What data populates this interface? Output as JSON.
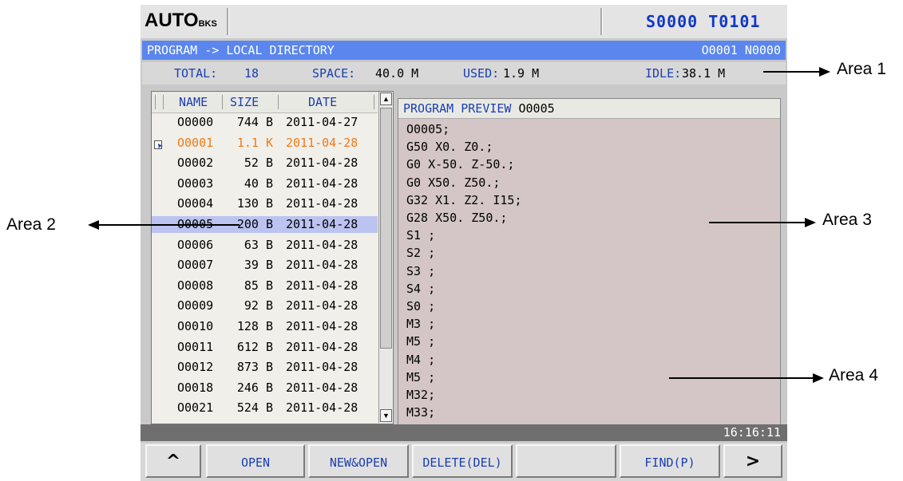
{
  "top_bar": {
    "mode": "AUTO",
    "mode_sub": "BKS",
    "spindle": "S0000",
    "tool": "T0101"
  },
  "title_bar": {
    "path": "PROGRAM -> LOCAL DIRECTORY",
    "program_info": "O0001 N0000"
  },
  "stats": {
    "total_label": "TOTAL:",
    "total_value": "18",
    "space_label": "SPACE:",
    "space_value": "40.0 M",
    "used_label": "USED:",
    "used_value": "1.9 M",
    "idle_label": "IDLE:",
    "idle_value": "38.1 M"
  },
  "file_list": {
    "headers": {
      "name": "NAME",
      "size": "SIZE",
      "date": "DATE"
    },
    "rows": [
      {
        "name": "O0000",
        "size": "744 B",
        "date": "2011-04-27"
      },
      {
        "name": "O0001",
        "size": "1.1 K",
        "date": "2011-04-28"
      },
      {
        "name": "O0002",
        "size": "52 B",
        "date": "2011-04-28"
      },
      {
        "name": "O0003",
        "size": "40 B",
        "date": "2011-04-28"
      },
      {
        "name": "O0004",
        "size": "130 B",
        "date": "2011-04-28"
      },
      {
        "name": "O0005",
        "size": "200 B",
        "date": "2011-04-28"
      },
      {
        "name": "O0006",
        "size": "63 B",
        "date": "2011-04-28"
      },
      {
        "name": "O0007",
        "size": "39 B",
        "date": "2011-04-28"
      },
      {
        "name": "O0008",
        "size": "85 B",
        "date": "2011-04-28"
      },
      {
        "name": "O0009",
        "size": "92 B",
        "date": "2011-04-28"
      },
      {
        "name": "O0010",
        "size": "128 B",
        "date": "2011-04-28"
      },
      {
        "name": "O0011",
        "size": "612 B",
        "date": "2011-04-28"
      },
      {
        "name": "O0012",
        "size": "873 B",
        "date": "2011-04-28"
      },
      {
        "name": "O0018",
        "size": "246 B",
        "date": "2011-04-28"
      },
      {
        "name": "O0021",
        "size": "524 B",
        "date": "2011-04-28"
      }
    ],
    "current_index": 1,
    "selected_index": 5
  },
  "preview": {
    "title": "PROGRAM PREVIEW",
    "program": "O0005",
    "lines": [
      "O0005;",
      "G50 X0. Z0.;",
      "G0 X-50. Z-50.;",
      "G0 X50. Z50.;",
      "G32 X1. Z2. I15;",
      "G28 X50. Z50.;",
      "S1 ;",
      "S2 ;",
      "S3 ;",
      "S4 ;",
      "S0 ;",
      "M3 ;",
      "M5 ;",
      "M4 ;",
      "M5 ;",
      "M32;",
      "M33;"
    ]
  },
  "status_bar": {
    "time": "16:16:11"
  },
  "softkeys": {
    "back": "^",
    "open": "OPEN",
    "new_open": "NEW&OPEN",
    "delete": "DELETE(DEL)",
    "empty": "",
    "find": "FIND(P)",
    "next": ">"
  },
  "annotations": {
    "area1": "Area 1",
    "area2": "Area 2",
    "area3": "Area 3",
    "area4": "Area 4"
  },
  "colors": {
    "title_bar": "#5a86ee",
    "label_blue": "#1a3fb0",
    "current_file": "#f07a18",
    "selected_row": "#bcc3f0",
    "preview_bg": "#d4c6c6"
  }
}
